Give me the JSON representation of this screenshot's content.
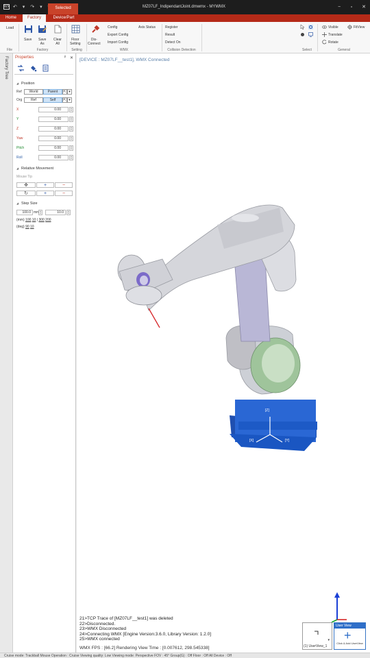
{
  "app": {
    "title": "MZ07LF_IndipendantJoint.dmwmx - MYWMX",
    "quick_access": "↶ ▾ ↷ ▾ ▾",
    "logo": "WX",
    "context_tab": "Selected",
    "window_controls": [
      "−",
      "▫",
      "✕"
    ]
  },
  "tabs": [
    {
      "label": "Home",
      "active": false
    },
    {
      "label": "Factory",
      "active": true
    },
    {
      "label": "Device/Part",
      "active": false
    }
  ],
  "ribbon": {
    "file": {
      "load": "Load",
      "group": "File"
    },
    "factory": {
      "save": "Save",
      "save_as": "Save\nAs",
      "clear_all": "Clear\nAll",
      "group": "Factory"
    },
    "setting": {
      "floor_setting": "Floor\nSetting",
      "group": "Setting"
    },
    "wmx": {
      "disconnect": "Dis-\nConnect",
      "config": "Config",
      "export_config": "Export Config",
      "import_config": "Import Config",
      "axis_status": "Axis Status",
      "group": "WMX"
    },
    "collision": {
      "register": "Register",
      "result": "Result",
      "detect_on": "Detect On",
      "group": "Collision Detection"
    },
    "select": {
      "group": "Select"
    },
    "general": {
      "visible": "Visible",
      "fit_view": "FitView",
      "translate": "Translate",
      "rotate": "Rotate",
      "group": "General"
    }
  },
  "side_strip": {
    "label": "Factory Tree"
  },
  "properties": {
    "title": "Properties",
    "pin": "ᵖ",
    "close": "✕",
    "position_section": "Position",
    "ref_label": "Ref",
    "ref_options": [
      "World",
      "Parent"
    ],
    "ref_selected": "Parent",
    "org_label": "Org",
    "org_options": [
      "Ref",
      "Self"
    ],
    "org_selected": "Self",
    "fields": [
      {
        "label": "X",
        "value": "0.00",
        "color": "#c0392b"
      },
      {
        "label": "Y",
        "value": "0.00",
        "color": "#1e8a2e"
      },
      {
        "label": "Z",
        "value": "0.00",
        "color": "#c0392b"
      },
      {
        "label": "Yaw",
        "value": "0.00",
        "color": "#c0392b"
      },
      {
        "label": "Pitch",
        "value": "0.00",
        "color": "#1e8a2e"
      },
      {
        "label": "Roll",
        "value": "0.00",
        "color": "#2e5fa8"
      }
    ],
    "relative_section": "Relative Movement",
    "mouse_tip": "Mouse Tip",
    "step_section": "Step Size",
    "step_mm": "100.0",
    "step_mm_unit": "mm",
    "step_deg": "10.0",
    "mm_presets_label": "(mm)",
    "mm_presets": [
      "100",
      "10",
      "300",
      "200"
    ],
    "deg_presets_label": "(deg)",
    "deg_presets": [
      "90",
      "10"
    ]
  },
  "viewport": {
    "device_label": "[DEVICE : MZ07LF__test1], WMX Connected",
    "axis_labels": [
      "[Z]",
      "[X]",
      "[Y]"
    ],
    "logs": [
      "21>TCP Trace of [MZ07LF__test1] was deleted",
      "22>Disconnected.",
      "23>WMX Disconnected",
      "24>Connecting WMX [Engine Version:3.6.0, Library Version: 1.2.0]",
      "25>WMX connected"
    ],
    "fps": "WMX FPS : [66.2] Rendering View Time : [0.007612, 298.545338]",
    "view_label": "(1) UserView_1",
    "user_view_header": "User View",
    "add_user_view": "Click & Add UserView"
  },
  "status_bar": "Cruise mode: Trackball    Mouse Operation : Cruise    Viewing quality: Low    Viewing mode: Perspective    FOV : 45°    Group(G) : Off    Floor : Off    All Device : Off",
  "colors": {
    "accent": "#b52a18",
    "selected_tab": "#c9432a",
    "robot_body": "#d6d6d9",
    "robot_base": "#1f5fc9",
    "robot_joint": "#8fb98c"
  }
}
